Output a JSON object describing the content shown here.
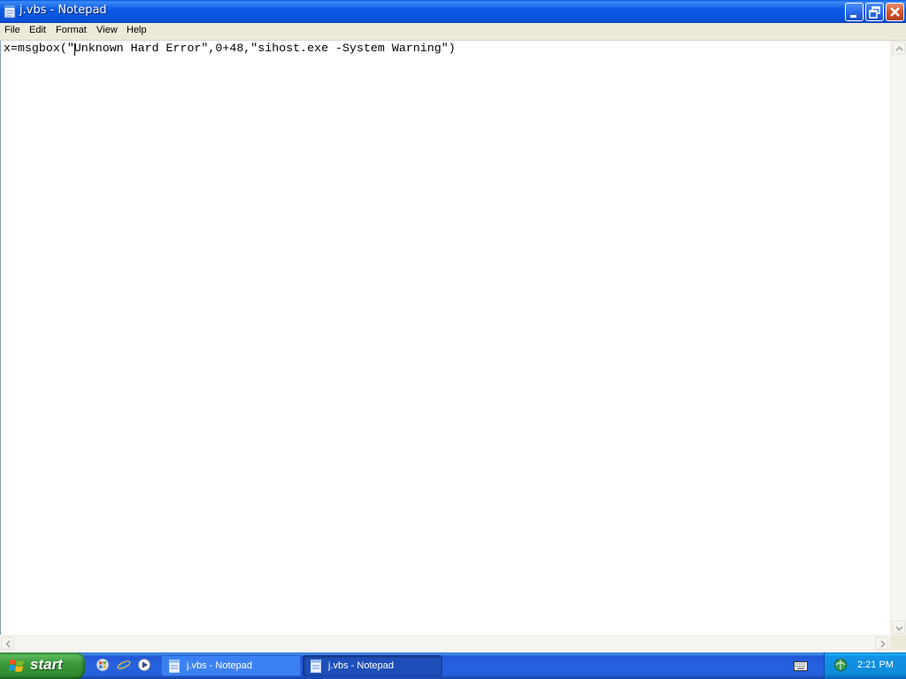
{
  "window": {
    "title": "j.vbs - Notepad",
    "app_icon": "notepad-icon",
    "controls": [
      "minimize-icon",
      "restore-icon",
      "close-icon"
    ]
  },
  "menubar": {
    "items": [
      {
        "label": "File"
      },
      {
        "label": "Edit"
      },
      {
        "label": "Format"
      },
      {
        "label": "View"
      },
      {
        "label": "Help"
      }
    ]
  },
  "editor": {
    "content": "x=msgbox(\"Unknown Hard Error\",0+48,\"sihost.exe -System Warning\")"
  },
  "taskbar": {
    "start_label": "start",
    "quick_launch": [
      "windows-update-icon",
      "internet-explorer-icon",
      "media-player-icon"
    ],
    "tasks": [
      {
        "label": "j.vbs - Notepad",
        "active": false
      },
      {
        "label": "j.vbs - Notepad",
        "active": true
      }
    ],
    "tray_icons": [
      "keyboard-icon",
      "network-icon"
    ],
    "clock": "2:21 PM"
  },
  "colors": {
    "titlebar_blue": "#0b5be6",
    "menubar_bg": "#ece9d8",
    "start_green": "#3b9a3b",
    "close_red": "#d24e25"
  }
}
